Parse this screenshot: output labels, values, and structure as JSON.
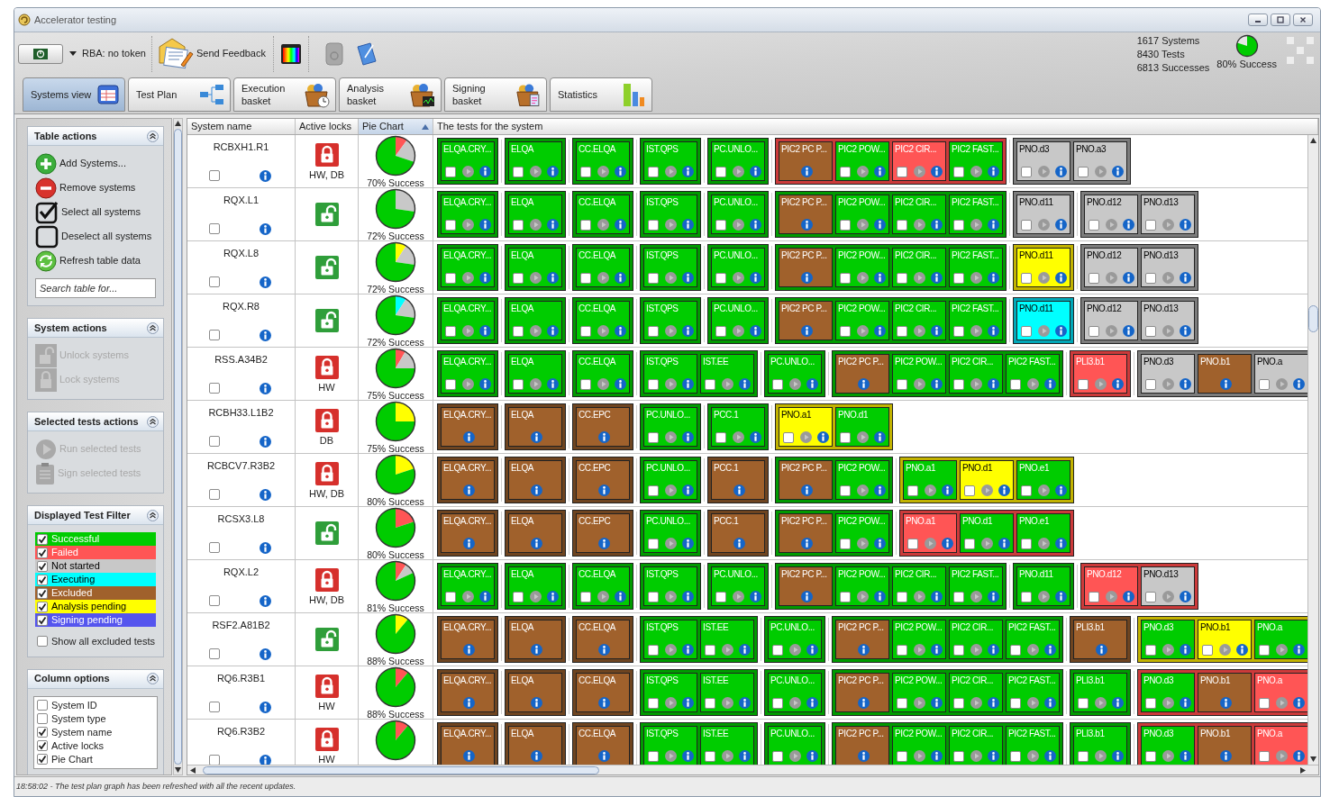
{
  "window": {
    "title": "Accelerator testing"
  },
  "toolbar": {
    "token_label": "RBA: no token",
    "feedback_label": "Send Feedback"
  },
  "summary": {
    "systems": "1617 Systems",
    "tests": "8430 Tests",
    "successes": "6813 Successes",
    "success_rate": "80% Success"
  },
  "tabs": [
    {
      "label": "Systems view",
      "selected": true
    },
    {
      "label": "Test Plan",
      "selected": false
    },
    {
      "label": "Execution basket",
      "selected": false
    },
    {
      "label": "Analysis basket",
      "selected": false
    },
    {
      "label": "Signing basket",
      "selected": false
    },
    {
      "label": "Statistics",
      "selected": false
    }
  ],
  "sidebar": {
    "sections": [
      {
        "kind": "actions",
        "title": "Table actions",
        "expanded": true,
        "items": [
          {
            "kind": "add",
            "label": "Add Systems...",
            "disabled": false
          },
          {
            "kind": "remove",
            "label": "Remove systems",
            "disabled": false
          },
          {
            "kind": "check",
            "label": "Select all systems",
            "disabled": false
          },
          {
            "kind": "uncheck",
            "label": "Deselect all systems",
            "disabled": false
          },
          {
            "kind": "refresh",
            "label": "Refresh table data",
            "disabled": false
          }
        ],
        "search": {
          "placeholder": "Search table for..."
        }
      },
      {
        "kind": "actions",
        "title": "System actions",
        "expanded": true,
        "items": [
          {
            "kind": "unlock",
            "label": "Unlock systems",
            "disabled": true
          },
          {
            "kind": "lock",
            "label": "Lock systems",
            "disabled": true
          }
        ]
      },
      {
        "kind": "actions",
        "title": "Selected tests actions",
        "expanded": true,
        "items": [
          {
            "kind": "run",
            "label": "Run selected tests",
            "disabled": true
          },
          {
            "kind": "sign",
            "label": "Sign selected tests",
            "disabled": true
          }
        ]
      },
      {
        "kind": "filter",
        "title": "Displayed Test Filter",
        "expanded": true,
        "items": [
          {
            "label": "Successful",
            "color": "#00cc00",
            "checked": true
          },
          {
            "label": "Failed",
            "color": "#ff5555",
            "checked": true
          },
          {
            "label": "Not started",
            "color": "#c8c8c8",
            "checked": true
          },
          {
            "label": "Executing",
            "color": "#00ffff",
            "checked": true
          },
          {
            "label": "Excluded",
            "color": "#a0612c",
            "checked": true
          },
          {
            "label": "Analysis pending",
            "color": "#ffff00",
            "checked": true
          },
          {
            "label": "Signing pending",
            "color": "#5555ee",
            "checked": true
          }
        ],
        "option": {
          "label": "Show all excluded tests",
          "checked": false
        }
      },
      {
        "kind": "columns",
        "title": "Column options",
        "expanded": true,
        "items": [
          {
            "label": "System ID",
            "checked": false
          },
          {
            "label": "System type",
            "checked": false
          },
          {
            "label": "System name",
            "checked": true
          },
          {
            "label": "Active locks",
            "checked": true
          },
          {
            "label": "Pie Chart",
            "checked": true
          }
        ]
      }
    ]
  },
  "table": {
    "columns": [
      {
        "label": "System name",
        "sorted": false
      },
      {
        "label": "Active locks",
        "sorted": false
      },
      {
        "label": "Pie Chart",
        "sorted": true
      },
      {
        "label": "The tests for the system",
        "sorted": false
      }
    ],
    "rows": [
      {
        "name": "RCBXH1.R1",
        "checked": false,
        "locked": true,
        "locks": "HW, DB",
        "success": "70% Success",
        "groups": [
          {
            "color": "#009a00",
            "tests": [
              {
                "label": "ELQA.CRY...",
                "color": "#00cc00",
                "kind": "active"
              }
            ]
          },
          {
            "color": "#009a00",
            "tests": [
              {
                "label": "ELQA",
                "color": "#00cc00",
                "kind": "active"
              }
            ]
          },
          {
            "color": "#009a00",
            "tests": [
              {
                "label": "CC.ELQA",
                "color": "#00cc00",
                "kind": "active"
              }
            ]
          },
          {
            "color": "#009a00",
            "tests": [
              {
                "label": "IST.QPS",
                "color": "#00cc00",
                "kind": "active"
              }
            ]
          },
          {
            "color": "#009a00",
            "tests": [
              {
                "label": "PC.UNLO...",
                "color": "#00cc00",
                "kind": "active"
              }
            ]
          },
          {
            "color": "#cc3a3a",
            "tests": [
              {
                "label": "PIC2 PC P...",
                "color": "#a0612c",
                "kind": "excluded"
              },
              {
                "label": "PIC2 POW...",
                "color": "#00cc00",
                "kind": "active"
              },
              {
                "label": "PIC2 CIR...",
                "color": "#ff5555",
                "kind": "active"
              },
              {
                "label": "PIC2 FAST...",
                "color": "#00cc00",
                "kind": "active"
              }
            ]
          },
          {
            "color": "#7c7c7c",
            "tests": [
              {
                "label": "PNO.d3",
                "color": "#c8c8c8",
                "kind": "active"
              },
              {
                "label": "PNO.a3",
                "color": "#c8c8c8",
                "kind": "active"
              }
            ]
          }
        ]
      },
      {
        "name": "RQX.L1",
        "checked": false,
        "locked": false,
        "success": "72% Success",
        "groups": [
          {
            "color": "#009a00",
            "tests": [
              {
                "label": "ELQA.CRY...",
                "color": "#00cc00",
                "kind": "active"
              }
            ]
          },
          {
            "color": "#009a00",
            "tests": [
              {
                "label": "ELQA",
                "color": "#00cc00",
                "kind": "active"
              }
            ]
          },
          {
            "color": "#009a00",
            "tests": [
              {
                "label": "CC.ELQA",
                "color": "#00cc00",
                "kind": "active"
              }
            ]
          },
          {
            "color": "#009a00",
            "tests": [
              {
                "label": "IST.QPS",
                "color": "#00cc00",
                "kind": "active"
              }
            ]
          },
          {
            "color": "#009a00",
            "tests": [
              {
                "label": "PC.UNLO...",
                "color": "#00cc00",
                "kind": "active"
              }
            ]
          },
          {
            "color": "#009a00",
            "tests": [
              {
                "label": "PIC2 PC P...",
                "color": "#a0612c",
                "kind": "excluded"
              },
              {
                "label": "PIC2 POW...",
                "color": "#00cc00",
                "kind": "active"
              },
              {
                "label": "PIC2 CIR...",
                "color": "#00cc00",
                "kind": "active"
              },
              {
                "label": "PIC2 FAST...",
                "color": "#00cc00",
                "kind": "active"
              }
            ]
          },
          {
            "color": "#7c7c7c",
            "tests": [
              {
                "label": "PNO.d11",
                "color": "#c8c8c8",
                "kind": "active"
              }
            ]
          },
          {
            "color": "#7c7c7c",
            "tests": [
              {
                "label": "PNO.d12",
                "color": "#c8c8c8",
                "kind": "active"
              },
              {
                "label": "PNO.d13",
                "color": "#c8c8c8",
                "kind": "active"
              }
            ]
          }
        ]
      },
      {
        "name": "RQX.L8",
        "checked": false,
        "locked": false,
        "success": "72% Success",
        "groups": [
          {
            "color": "#009a00",
            "tests": [
              {
                "label": "ELQA.CRY...",
                "color": "#00cc00",
                "kind": "active"
              }
            ]
          },
          {
            "color": "#009a00",
            "tests": [
              {
                "label": "ELQA",
                "color": "#00cc00",
                "kind": "active"
              }
            ]
          },
          {
            "color": "#009a00",
            "tests": [
              {
                "label": "CC.ELQA",
                "color": "#00cc00",
                "kind": "active"
              }
            ]
          },
          {
            "color": "#009a00",
            "tests": [
              {
                "label": "IST.QPS",
                "color": "#00cc00",
                "kind": "active"
              }
            ]
          },
          {
            "color": "#009a00",
            "tests": [
              {
                "label": "PC.UNLO...",
                "color": "#00cc00",
                "kind": "active"
              }
            ]
          },
          {
            "color": "#009a00",
            "tests": [
              {
                "label": "PIC2 PC P...",
                "color": "#a0612c",
                "kind": "excluded"
              },
              {
                "label": "PIC2 POW...",
                "color": "#00cc00",
                "kind": "active"
              },
              {
                "label": "PIC2 CIR...",
                "color": "#00cc00",
                "kind": "active"
              },
              {
                "label": "PIC2 FAST...",
                "color": "#00cc00",
                "kind": "active"
              }
            ]
          },
          {
            "color": "#c2b300",
            "tests": [
              {
                "label": "PNO.d11",
                "color": "#ffff00",
                "kind": "active"
              }
            ]
          },
          {
            "color": "#7c7c7c",
            "tests": [
              {
                "label": "PNO.d12",
                "color": "#c8c8c8",
                "kind": "active"
              },
              {
                "label": "PNO.d13",
                "color": "#c8c8c8",
                "kind": "active"
              }
            ]
          }
        ]
      },
      {
        "name": "RQX.R8",
        "checked": false,
        "locked": false,
        "success": "72% Success",
        "groups": [
          {
            "color": "#009a00",
            "tests": [
              {
                "label": "ELQA.CRY...",
                "color": "#00cc00",
                "kind": "active"
              }
            ]
          },
          {
            "color": "#009a00",
            "tests": [
              {
                "label": "ELQA",
                "color": "#00cc00",
                "kind": "active"
              }
            ]
          },
          {
            "color": "#009a00",
            "tests": [
              {
                "label": "CC.ELQA",
                "color": "#00cc00",
                "kind": "active"
              }
            ]
          },
          {
            "color": "#009a00",
            "tests": [
              {
                "label": "IST.QPS",
                "color": "#00cc00",
                "kind": "active"
              }
            ]
          },
          {
            "color": "#009a00",
            "tests": [
              {
                "label": "PC.UNLO...",
                "color": "#00cc00",
                "kind": "active"
              }
            ]
          },
          {
            "color": "#009a00",
            "tests": [
              {
                "label": "PIC2 PC P...",
                "color": "#a0612c",
                "kind": "excluded"
              },
              {
                "label": "PIC2 POW...",
                "color": "#00cc00",
                "kind": "active"
              },
              {
                "label": "PIC2 CIR...",
                "color": "#00cc00",
                "kind": "active"
              },
              {
                "label": "PIC2 FAST...",
                "color": "#00cc00",
                "kind": "active"
              }
            ]
          },
          {
            "color": "#00a8b8",
            "tests": [
              {
                "label": "PNO.d11",
                "color": "#00ffff",
                "kind": "active"
              }
            ]
          },
          {
            "color": "#7c7c7c",
            "tests": [
              {
                "label": "PNO.d12",
                "color": "#c8c8c8",
                "kind": "active"
              },
              {
                "label": "PNO.d13",
                "color": "#c8c8c8",
                "kind": "active"
              }
            ]
          }
        ]
      },
      {
        "name": "RSS.A34B2",
        "checked": false,
        "locked": true,
        "locks": "HW",
        "success": "75% Success",
        "groups": [
          {
            "color": "#009a00",
            "tests": [
              {
                "label": "ELQA.CRY...",
                "color": "#00cc00",
                "kind": "active"
              }
            ]
          },
          {
            "color": "#009a00",
            "tests": [
              {
                "label": "ELQA",
                "color": "#00cc00",
                "kind": "active"
              }
            ]
          },
          {
            "color": "#009a00",
            "tests": [
              {
                "label": "CC.ELQA",
                "color": "#00cc00",
                "kind": "active"
              }
            ]
          },
          {
            "color": "#009a00",
            "tests": [
              {
                "label": "IST.QPS",
                "color": "#00cc00",
                "kind": "active"
              },
              {
                "label": "IST.EE",
                "color": "#00cc00",
                "kind": "active"
              }
            ]
          },
          {
            "color": "#009a00",
            "tests": [
              {
                "label": "PC.UNLO...",
                "color": "#00cc00",
                "kind": "active"
              }
            ]
          },
          {
            "color": "#009a00",
            "tests": [
              {
                "label": "PIC2 PC P...",
                "color": "#a0612c",
                "kind": "excluded"
              },
              {
                "label": "PIC2 POW...",
                "color": "#00cc00",
                "kind": "active"
              },
              {
                "label": "PIC2 CIR...",
                "color": "#00cc00",
                "kind": "active"
              },
              {
                "label": "PIC2 FAST...",
                "color": "#00cc00",
                "kind": "active"
              }
            ]
          },
          {
            "color": "#cc3a3a",
            "tests": [
              {
                "label": "PLI3.b1",
                "color": "#ff5555",
                "kind": "active"
              }
            ]
          },
          {
            "color": "#7c7c7c",
            "tests": [
              {
                "label": "PNO.d3",
                "color": "#c8c8c8",
                "kind": "active"
              },
              {
                "label": "PNO.b1",
                "color": "#a0612c",
                "kind": "excluded"
              },
              {
                "label": "PNO.a",
                "color": "#c8c8c8",
                "kind": "active"
              }
            ]
          }
        ]
      },
      {
        "name": "RCBH33.L1B2",
        "checked": false,
        "locked": true,
        "locks": "DB",
        "success": "75% Success",
        "groups": [
          {
            "color": "#6e4420",
            "tests": [
              {
                "label": "ELQA.CRY...",
                "color": "#a0612c",
                "kind": "excluded"
              }
            ]
          },
          {
            "color": "#6e4420",
            "tests": [
              {
                "label": "ELQA",
                "color": "#a0612c",
                "kind": "excluded"
              }
            ]
          },
          {
            "color": "#6e4420",
            "tests": [
              {
                "label": "CC.EPC",
                "color": "#a0612c",
                "kind": "excluded"
              }
            ]
          },
          {
            "color": "#009a00",
            "tests": [
              {
                "label": "PC.UNLO...",
                "color": "#00cc00",
                "kind": "active"
              }
            ]
          },
          {
            "color": "#009a00",
            "tests": [
              {
                "label": "PCC.1",
                "color": "#00cc00",
                "kind": "active"
              }
            ]
          },
          {
            "color": "#c2b300",
            "tests": [
              {
                "label": "PNO.a1",
                "color": "#ffff00",
                "kind": "active"
              },
              {
                "label": "PNO.d1",
                "color": "#00cc00",
                "kind": "active"
              }
            ]
          }
        ]
      },
      {
        "name": "RCBCV7.R3B2",
        "checked": false,
        "locked": true,
        "locks": "HW, DB",
        "success": "80% Success",
        "groups": [
          {
            "color": "#6e4420",
            "tests": [
              {
                "label": "ELQA.CRY...",
                "color": "#a0612c",
                "kind": "excluded"
              }
            ]
          },
          {
            "color": "#6e4420",
            "tests": [
              {
                "label": "ELQA",
                "color": "#a0612c",
                "kind": "excluded"
              }
            ]
          },
          {
            "color": "#6e4420",
            "tests": [
              {
                "label": "CC.EPC",
                "color": "#a0612c",
                "kind": "excluded"
              }
            ]
          },
          {
            "color": "#009a00",
            "tests": [
              {
                "label": "PC.UNLO...",
                "color": "#00cc00",
                "kind": "active"
              }
            ]
          },
          {
            "color": "#6e4420",
            "tests": [
              {
                "label": "PCC.1",
                "color": "#a0612c",
                "kind": "excluded"
              }
            ]
          },
          {
            "color": "#009a00",
            "tests": [
              {
                "label": "PIC2 PC P...",
                "color": "#a0612c",
                "kind": "excluded"
              },
              {
                "label": "PIC2 POW...",
                "color": "#00cc00",
                "kind": "active"
              }
            ]
          },
          {
            "color": "#c2b300",
            "tests": [
              {
                "label": "PNO.a1",
                "color": "#00cc00",
                "kind": "active"
              },
              {
                "label": "PNO.d1",
                "color": "#ffff00",
                "kind": "active"
              },
              {
                "label": "PNO.e1",
                "color": "#00cc00",
                "kind": "active"
              }
            ]
          }
        ]
      },
      {
        "name": "RCSX3.L8",
        "checked": false,
        "locked": false,
        "success": "80% Success",
        "groups": [
          {
            "color": "#6e4420",
            "tests": [
              {
                "label": "ELQA.CRY...",
                "color": "#a0612c",
                "kind": "excluded"
              }
            ]
          },
          {
            "color": "#6e4420",
            "tests": [
              {
                "label": "ELQA",
                "color": "#a0612c",
                "kind": "excluded"
              }
            ]
          },
          {
            "color": "#6e4420",
            "tests": [
              {
                "label": "CC.EPC",
                "color": "#a0612c",
                "kind": "excluded"
              }
            ]
          },
          {
            "color": "#009a00",
            "tests": [
              {
                "label": "PC.UNLO...",
                "color": "#00cc00",
                "kind": "active"
              }
            ]
          },
          {
            "color": "#6e4420",
            "tests": [
              {
                "label": "PCC.1",
                "color": "#a0612c",
                "kind": "excluded"
              }
            ]
          },
          {
            "color": "#009a00",
            "tests": [
              {
                "label": "PIC2 PC P...",
                "color": "#a0612c",
                "kind": "excluded"
              },
              {
                "label": "PIC2 POW...",
                "color": "#00cc00",
                "kind": "active"
              }
            ]
          },
          {
            "color": "#cc3a3a",
            "tests": [
              {
                "label": "PNO.a1",
                "color": "#ff5555",
                "kind": "active"
              },
              {
                "label": "PNO.d1",
                "color": "#00cc00",
                "kind": "active"
              },
              {
                "label": "PNO.e1",
                "color": "#00cc00",
                "kind": "active"
              }
            ]
          }
        ]
      },
      {
        "name": "RQX.L2",
        "checked": false,
        "locked": true,
        "locks": "HW, DB",
        "success": "81% Success",
        "groups": [
          {
            "color": "#009a00",
            "tests": [
              {
                "label": "ELQA.CRY...",
                "color": "#00cc00",
                "kind": "active"
              }
            ]
          },
          {
            "color": "#009a00",
            "tests": [
              {
                "label": "ELQA",
                "color": "#00cc00",
                "kind": "active"
              }
            ]
          },
          {
            "color": "#009a00",
            "tests": [
              {
                "label": "CC.ELQA",
                "color": "#00cc00",
                "kind": "active"
              }
            ]
          },
          {
            "color": "#009a00",
            "tests": [
              {
                "label": "IST.QPS",
                "color": "#00cc00",
                "kind": "active"
              }
            ]
          },
          {
            "color": "#009a00",
            "tests": [
              {
                "label": "PC.UNLO...",
                "color": "#00cc00",
                "kind": "active"
              }
            ]
          },
          {
            "color": "#009a00",
            "tests": [
              {
                "label": "PIC2 PC P...",
                "color": "#a0612c",
                "kind": "excluded"
              },
              {
                "label": "PIC2 POW...",
                "color": "#00cc00",
                "kind": "active"
              },
              {
                "label": "PIC2 CIR...",
                "color": "#00cc00",
                "kind": "active"
              },
              {
                "label": "PIC2 FAST...",
                "color": "#00cc00",
                "kind": "active"
              }
            ]
          },
          {
            "color": "#009a00",
            "tests": [
              {
                "label": "PNO.d11",
                "color": "#00cc00",
                "kind": "active"
              }
            ]
          },
          {
            "color": "#cc3a3a",
            "tests": [
              {
                "label": "PNO.d12",
                "color": "#ff5555",
                "kind": "active"
              },
              {
                "label": "PNO.d13",
                "color": "#c8c8c8",
                "kind": "active"
              }
            ]
          }
        ]
      },
      {
        "name": "RSF2.A81B2",
        "checked": false,
        "locked": false,
        "success": "88% Success",
        "groups": [
          {
            "color": "#6e4420",
            "tests": [
              {
                "label": "ELQA.CRY...",
                "color": "#a0612c",
                "kind": "excluded"
              }
            ]
          },
          {
            "color": "#6e4420",
            "tests": [
              {
                "label": "ELQA",
                "color": "#a0612c",
                "kind": "excluded"
              }
            ]
          },
          {
            "color": "#6e4420",
            "tests": [
              {
                "label": "CC.ELQA",
                "color": "#a0612c",
                "kind": "excluded"
              }
            ]
          },
          {
            "color": "#009a00",
            "tests": [
              {
                "label": "IST.QPS",
                "color": "#00cc00",
                "kind": "active"
              },
              {
                "label": "IST.EE",
                "color": "#00cc00",
                "kind": "active"
              }
            ]
          },
          {
            "color": "#009a00",
            "tests": [
              {
                "label": "PC.UNLO...",
                "color": "#00cc00",
                "kind": "active"
              }
            ]
          },
          {
            "color": "#009a00",
            "tests": [
              {
                "label": "PIC2 PC P...",
                "color": "#a0612c",
                "kind": "excluded"
              },
              {
                "label": "PIC2 POW...",
                "color": "#00cc00",
                "kind": "active"
              },
              {
                "label": "PIC2 CIR...",
                "color": "#00cc00",
                "kind": "active"
              },
              {
                "label": "PIC2 FAST...",
                "color": "#00cc00",
                "kind": "active"
              }
            ]
          },
          {
            "color": "#6e4420",
            "tests": [
              {
                "label": "PLI3.b1",
                "color": "#a0612c",
                "kind": "excluded"
              }
            ]
          },
          {
            "color": "#c2b300",
            "tests": [
              {
                "label": "PNO.d3",
                "color": "#00cc00",
                "kind": "active"
              },
              {
                "label": "PNO.b1",
                "color": "#ffff00",
                "kind": "active"
              },
              {
                "label": "PNO.a",
                "color": "#00cc00",
                "kind": "active"
              }
            ]
          }
        ]
      },
      {
        "name": "RQ6.R3B1",
        "checked": false,
        "locked": true,
        "locks": "HW",
        "success": "88% Success",
        "groups": [
          {
            "color": "#6e4420",
            "tests": [
              {
                "label": "ELQA.CRY...",
                "color": "#a0612c",
                "kind": "excluded"
              }
            ]
          },
          {
            "color": "#6e4420",
            "tests": [
              {
                "label": "ELQA",
                "color": "#a0612c",
                "kind": "excluded"
              }
            ]
          },
          {
            "color": "#6e4420",
            "tests": [
              {
                "label": "CC.ELQA",
                "color": "#a0612c",
                "kind": "excluded"
              }
            ]
          },
          {
            "color": "#009a00",
            "tests": [
              {
                "label": "IST.QPS",
                "color": "#00cc00",
                "kind": "active"
              },
              {
                "label": "IST.EE",
                "color": "#00cc00",
                "kind": "active"
              }
            ]
          },
          {
            "color": "#009a00",
            "tests": [
              {
                "label": "PC.UNLO...",
                "color": "#00cc00",
                "kind": "active"
              }
            ]
          },
          {
            "color": "#009a00",
            "tests": [
              {
                "label": "PIC2 PC P...",
                "color": "#a0612c",
                "kind": "excluded"
              },
              {
                "label": "PIC2 POW...",
                "color": "#00cc00",
                "kind": "active"
              },
              {
                "label": "PIC2 CIR...",
                "color": "#00cc00",
                "kind": "active"
              },
              {
                "label": "PIC2 FAST...",
                "color": "#00cc00",
                "kind": "active"
              }
            ]
          },
          {
            "color": "#009a00",
            "tests": [
              {
                "label": "PLI3.b1",
                "color": "#00cc00",
                "kind": "active"
              }
            ]
          },
          {
            "color": "#cc3a3a",
            "tests": [
              {
                "label": "PNO.d3",
                "color": "#00cc00",
                "kind": "active"
              },
              {
                "label": "PNO.b1",
                "color": "#a0612c",
                "kind": "excluded"
              },
              {
                "label": "PNO.a",
                "color": "#ff5555",
                "kind": "active"
              }
            ]
          }
        ]
      },
      {
        "name": "RQ6.R3B2",
        "checked": false,
        "locked": true,
        "locks": "HW",
        "groups": [
          {
            "color": "#6e4420",
            "tests": [
              {
                "label": "ELQA.CRY...",
                "color": "#a0612c",
                "kind": "excluded"
              }
            ]
          },
          {
            "color": "#6e4420",
            "tests": [
              {
                "label": "ELQA",
                "color": "#a0612c",
                "kind": "excluded"
              }
            ]
          },
          {
            "color": "#6e4420",
            "tests": [
              {
                "label": "CC.ELQA",
                "color": "#a0612c",
                "kind": "excluded"
              }
            ]
          },
          {
            "color": "#009a00",
            "tests": [
              {
                "label": "IST.QPS",
                "color": "#00cc00",
                "kind": "active"
              },
              {
                "label": "IST.EE",
                "color": "#00cc00",
                "kind": "active"
              }
            ]
          },
          {
            "color": "#009a00",
            "tests": [
              {
                "label": "PC.UNLO...",
                "color": "#00cc00",
                "kind": "active"
              }
            ]
          },
          {
            "color": "#009a00",
            "tests": [
              {
                "label": "PIC2 PC P...",
                "color": "#a0612c",
                "kind": "excluded"
              },
              {
                "label": "PIC2 POW...",
                "color": "#00cc00",
                "kind": "active"
              },
              {
                "label": "PIC2 CIR...",
                "color": "#00cc00",
                "kind": "active"
              },
              {
                "label": "PIC2 FAST...",
                "color": "#00cc00",
                "kind": "active"
              }
            ]
          },
          {
            "color": "#009a00",
            "tests": [
              {
                "label": "PLI3.b1",
                "color": "#00cc00",
                "kind": "active"
              }
            ]
          },
          {
            "color": "#cc3a3a",
            "tests": [
              {
                "label": "PNO.d3",
                "color": "#00cc00",
                "kind": "active"
              },
              {
                "label": "PNO.b1",
                "color": "#a0612c",
                "kind": "excluded"
              },
              {
                "label": "PNO.a",
                "color": "#ff5555",
                "kind": "active"
              }
            ]
          }
        ]
      }
    ]
  },
  "status_bar": {
    "message": "18:58:02 - The test plan graph has been refreshed with all the recent updates."
  }
}
